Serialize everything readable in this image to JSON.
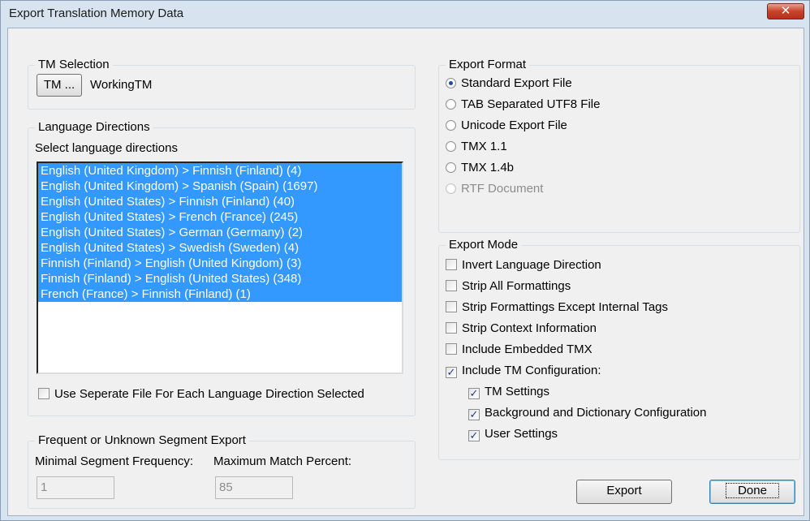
{
  "window": {
    "title": "Export Translation Memory Data",
    "close_glyph": "✕"
  },
  "tm_selection": {
    "legend": "TM Selection",
    "button_label": "TM ...",
    "tm_name": "WorkingTM"
  },
  "language_directions": {
    "legend": "Language Directions",
    "caption": "Select language directions",
    "items": [
      "English (United Kingdom) > Finnish (Finland) (4)",
      "English (United Kingdom) > Spanish (Spain) (1697)",
      "English (United States) > Finnish (Finland) (40)",
      "English (United States) > French (France) (245)",
      "English (United States) > German (Germany) (2)",
      "English (United States) > Swedish (Sweden) (4)",
      "Finnish (Finland) > English (United Kingdom) (3)",
      "Finnish (Finland) > English (United States) (348)",
      "French (France) > Finnish (Finland) (1)"
    ],
    "separate_file_label": "Use Seperate File For Each Language Direction Selected",
    "separate_file_checked": false
  },
  "segment_export": {
    "legend": "Frequent or Unknown Segment Export",
    "min_freq_label": "Minimal Segment Frequency:",
    "max_match_label": "Maximum Match Percent:",
    "min_freq_value": "1",
    "max_match_value": "85"
  },
  "export_format": {
    "legend": "Export Format",
    "options": [
      {
        "label": "Standard Export File",
        "selected": true,
        "enabled": true
      },
      {
        "label": "TAB Separated UTF8 File",
        "selected": false,
        "enabled": true
      },
      {
        "label": "Unicode Export File",
        "selected": false,
        "enabled": true
      },
      {
        "label": "TMX 1.1",
        "selected": false,
        "enabled": true
      },
      {
        "label": "TMX 1.4b",
        "selected": false,
        "enabled": true
      },
      {
        "label": "RTF Document",
        "selected": false,
        "enabled": false
      }
    ]
  },
  "export_mode": {
    "legend": "Export Mode",
    "options": [
      {
        "label": "Invert Language Direction",
        "checked": false
      },
      {
        "label": "Strip All Formattings",
        "checked": false
      },
      {
        "label": "Strip Formattings Except Internal Tags",
        "checked": false
      },
      {
        "label": "Strip Context Information",
        "checked": false
      },
      {
        "label": "Include Embedded TMX",
        "checked": false
      },
      {
        "label": "Include TM Configuration:",
        "checked": true
      }
    ],
    "sub_options": [
      {
        "label": "TM Settings",
        "checked": true
      },
      {
        "label": "Background and Dictionary Configuration",
        "checked": true
      },
      {
        "label": "User Settings",
        "checked": true
      }
    ]
  },
  "buttons": {
    "export": "Export",
    "done": "Done"
  },
  "colors": {
    "selection": "#3399ff",
    "dialog_bg": "#f0f0f0",
    "frame": "#d8e3f0",
    "close": "#c7432a"
  }
}
